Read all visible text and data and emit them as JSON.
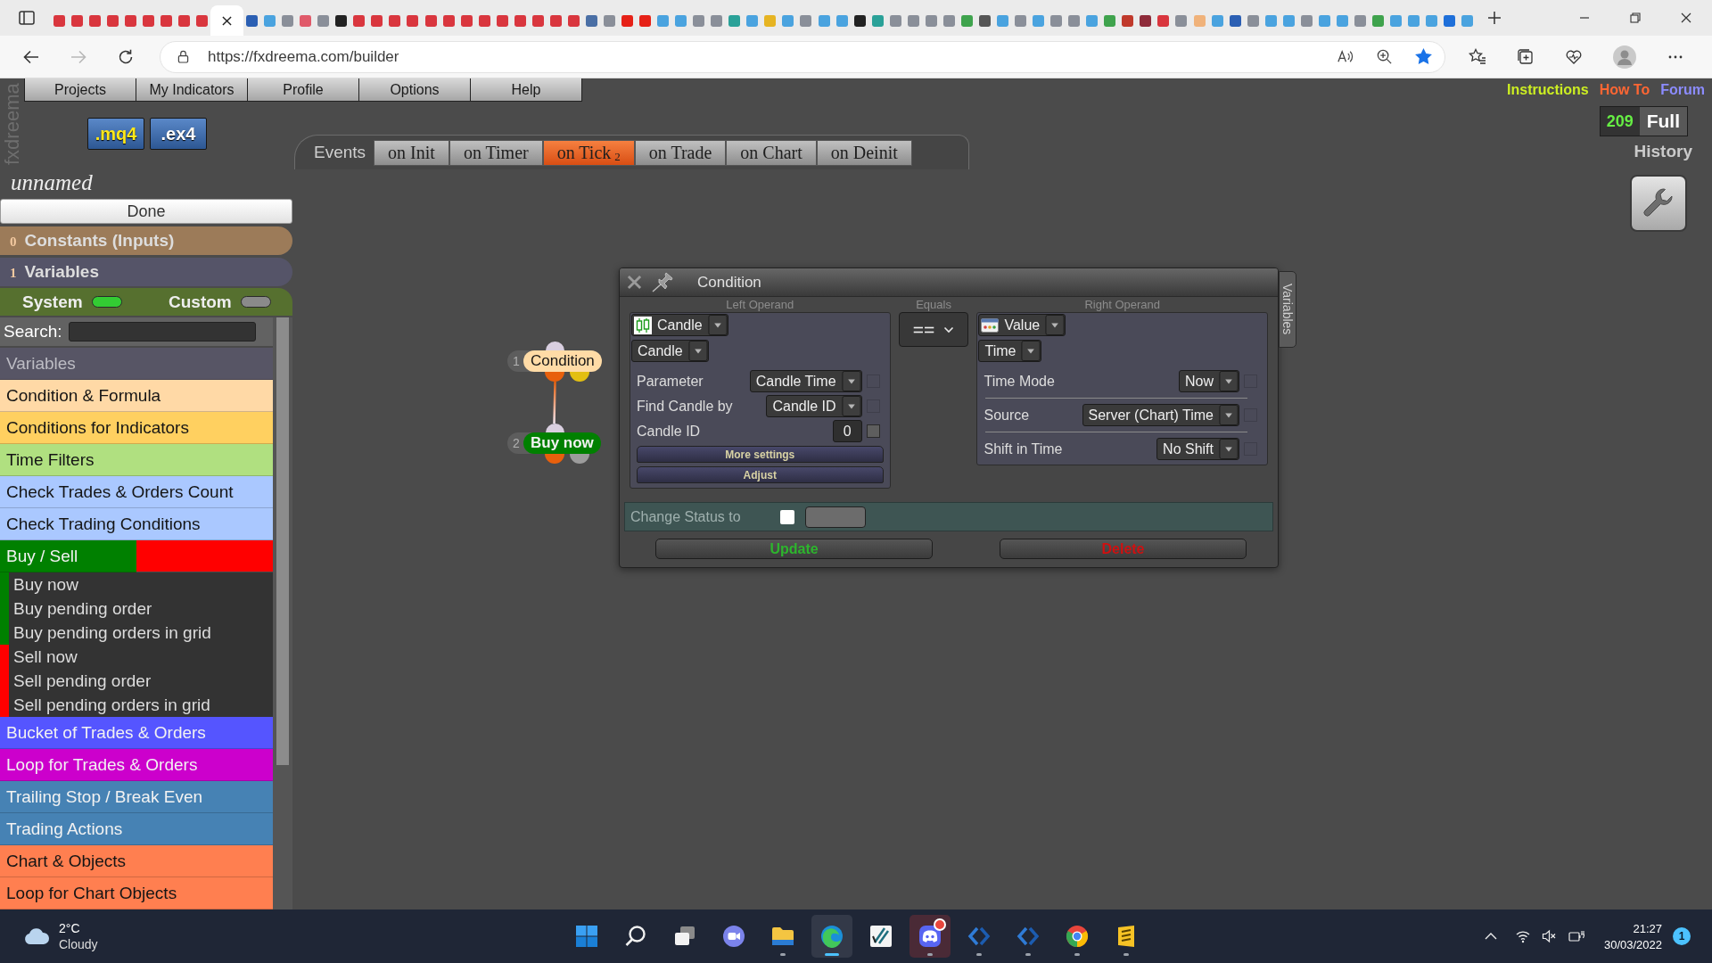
{
  "browser": {
    "tabs": [
      {
        "selected": false,
        "color": "#d9363e"
      },
      {
        "selected": false,
        "color": "#d9363e"
      },
      {
        "selected": false,
        "color": "#d9363e"
      },
      {
        "selected": false,
        "color": "#d9363e"
      },
      {
        "selected": false,
        "color": "#d9363e"
      },
      {
        "selected": false,
        "color": "#d9363e"
      },
      {
        "selected": false,
        "color": "#d9363e"
      },
      {
        "selected": false,
        "color": "#d9363e"
      },
      {
        "selected": false,
        "color": "#d9363e"
      },
      {
        "selected": true
      },
      {
        "selected": false,
        "color": "#2b5fb3"
      },
      {
        "selected": false,
        "color": "#4aa3df"
      },
      {
        "selected": false,
        "color": "#8a8f99"
      },
      {
        "selected": false,
        "color": "#e05a6a"
      },
      {
        "selected": false,
        "color": "#8a8f99"
      },
      {
        "selected": false,
        "color": "#222222"
      },
      {
        "selected": false,
        "color": "#d9363e"
      },
      {
        "selected": false,
        "color": "#d9363e"
      },
      {
        "selected": false,
        "color": "#d9363e"
      },
      {
        "selected": false,
        "color": "#d9363e"
      },
      {
        "selected": false,
        "color": "#d9363e"
      },
      {
        "selected": false,
        "color": "#d9363e"
      },
      {
        "selected": false,
        "color": "#d9363e"
      },
      {
        "selected": false,
        "color": "#d9363e"
      },
      {
        "selected": false,
        "color": "#d9363e"
      },
      {
        "selected": false,
        "color": "#d9363e"
      },
      {
        "selected": false,
        "color": "#d9363e"
      },
      {
        "selected": false,
        "color": "#d9363e"
      },
      {
        "selected": false,
        "color": "#d9363e"
      },
      {
        "selected": false,
        "color": "#4a6fa5"
      },
      {
        "selected": false,
        "color": "#8a8f99"
      },
      {
        "selected": false,
        "color": "#e62117"
      },
      {
        "selected": false,
        "color": "#e62117"
      },
      {
        "selected": false,
        "color": "#4aa3df"
      },
      {
        "selected": false,
        "color": "#4aa3df"
      },
      {
        "selected": false,
        "color": "#8a8f99"
      },
      {
        "selected": false,
        "color": "#8a8f99"
      },
      {
        "selected": false,
        "color": "#2aa198"
      },
      {
        "selected": false,
        "color": "#4aa3df"
      },
      {
        "selected": false,
        "color": "#e6b422"
      },
      {
        "selected": false,
        "color": "#4aa3df"
      },
      {
        "selected": false,
        "color": "#8a8f99"
      },
      {
        "selected": false,
        "color": "#4aa3df"
      },
      {
        "selected": false,
        "color": "#4aa3df"
      },
      {
        "selected": false,
        "color": "#222222"
      },
      {
        "selected": false,
        "color": "#2aa198"
      },
      {
        "selected": false,
        "color": "#8a8f99"
      },
      {
        "selected": false,
        "color": "#8a8f99"
      },
      {
        "selected": false,
        "color": "#8a8f99"
      },
      {
        "selected": false,
        "color": "#8a8f99"
      },
      {
        "selected": false,
        "color": "#3fa34d"
      },
      {
        "selected": false,
        "color": "#555555"
      },
      {
        "selected": false,
        "color": "#4aa3df"
      },
      {
        "selected": false,
        "color": "#8a8f99"
      },
      {
        "selected": false,
        "color": "#4aa3df"
      },
      {
        "selected": false,
        "color": "#8a8f99"
      },
      {
        "selected": false,
        "color": "#8a8f99"
      },
      {
        "selected": false,
        "color": "#4aa3df"
      },
      {
        "selected": false,
        "color": "#3fa34d"
      },
      {
        "selected": false,
        "color": "#c0392b"
      },
      {
        "selected": false,
        "color": "#8e2b3a"
      },
      {
        "selected": false,
        "color": "#d9363e"
      },
      {
        "selected": false,
        "color": "#8a8f99"
      },
      {
        "selected": false,
        "color": "#f0b27a"
      },
      {
        "selected": false,
        "color": "#4aa3df"
      },
      {
        "selected": false,
        "color": "#2b5fb3"
      },
      {
        "selected": false,
        "color": "#8a8f99"
      },
      {
        "selected": false,
        "color": "#4aa3df"
      },
      {
        "selected": false,
        "color": "#4aa3df"
      },
      {
        "selected": false,
        "color": "#8a8f99"
      },
      {
        "selected": false,
        "color": "#4aa3df"
      },
      {
        "selected": false,
        "color": "#4aa3df"
      },
      {
        "selected": false,
        "color": "#8a8f99"
      },
      {
        "selected": false,
        "color": "#3fa34d"
      },
      {
        "selected": false,
        "color": "#4aa3df"
      },
      {
        "selected": false,
        "color": "#4aa3df"
      },
      {
        "selected": false,
        "color": "#4aa3df"
      },
      {
        "selected": false,
        "color": "#1e6fd9"
      },
      {
        "selected": false,
        "color": "#4aa3df"
      }
    ],
    "nav": [
      {
        "kind": "back",
        "disabled": false
      },
      {
        "kind": "forward",
        "disabled": true
      },
      {
        "kind": "refresh",
        "disabled": false
      }
    ],
    "address": "https://fxdreema.com/builder",
    "favorited": true
  },
  "app": {
    "logo": "fxdreema",
    "menu": [
      "Projects",
      "My Indicators",
      "Profile",
      "Options",
      "Help"
    ],
    "links": [
      {
        "label": "Instructions",
        "color": "#ccee22"
      },
      {
        "label": "How To",
        "color": "#ff6633"
      },
      {
        "label": "Forum",
        "color": "#8c8cff"
      }
    ],
    "exports": [
      {
        "label": ".mq4",
        "kind": "source"
      },
      {
        "label": ".ex4",
        "kind": "compiled"
      }
    ],
    "events": {
      "label": "Events",
      "tabs": [
        {
          "label": "on Init",
          "selected": false
        },
        {
          "label": "on Timer",
          "selected": false
        },
        {
          "label": "on Tick",
          "count": "2",
          "selected": true
        },
        {
          "label": "on Trade",
          "selected": false
        },
        {
          "label": "on Chart",
          "selected": false
        },
        {
          "label": "on Deinit",
          "selected": false
        }
      ]
    },
    "stats": {
      "count": "209",
      "plan": "Full",
      "history": "History"
    },
    "project": {
      "name": "unnamed",
      "done": "Done"
    },
    "sections": [
      {
        "count": "0",
        "label": "Constants (Inputs)",
        "color": "#9c7b59"
      },
      {
        "count": "1",
        "label": "Variables",
        "color": "#555468"
      }
    ],
    "scope_toggles": [
      {
        "label": "System",
        "on": true
      },
      {
        "label": "Custom",
        "on": false
      }
    ],
    "search": {
      "label": "Search:"
    },
    "blocks": [
      {
        "label": "Variables",
        "kind": "muted",
        "color": "#575565"
      },
      {
        "label": "Condition & Formula",
        "kind": "category",
        "color": "#ffd9a6"
      },
      {
        "label": "Conditions for Indicators",
        "kind": "category",
        "color": "#ffd060"
      },
      {
        "label": "Time Filters",
        "kind": "category",
        "color": "#b0e080"
      },
      {
        "label": "Check Trades & Orders Count",
        "kind": "category",
        "color": "#aac8ff"
      },
      {
        "label": "Check Trading Conditions",
        "kind": "category",
        "color": "#aac8ff"
      },
      {
        "label": "Buy / Sell",
        "kind": "split",
        "halves": [
          {
            "color": "#008000"
          },
          {
            "color": "#ff0000"
          }
        ],
        "children": [
          {
            "label": "Buy now",
            "color": "#008000"
          },
          {
            "label": "Buy pending order",
            "color": "#008000"
          },
          {
            "label": "Buy pending orders in grid",
            "color": "#008000"
          },
          {
            "label": "Sell now",
            "color": "#ff0000"
          },
          {
            "label": "Sell pending order",
            "color": "#ff0000"
          },
          {
            "label": "Sell pending orders in grid",
            "color": "#ff0000"
          }
        ]
      },
      {
        "label": "Bucket of Trades & Orders",
        "kind": "category",
        "color": "#5555ff"
      },
      {
        "label": "Loop for Trades & Orders",
        "kind": "category",
        "color": "#cc00cc"
      },
      {
        "label": "Trailing Stop / Break Even",
        "kind": "category",
        "color": "#4682b4"
      },
      {
        "label": "Trading Actions",
        "kind": "category",
        "color": "#4682b4"
      },
      {
        "label": "Chart & Objects",
        "kind": "category",
        "color": "#ff7f50"
      },
      {
        "label": "Loop for Chart Objects",
        "kind": "category",
        "color": "#ff7f50"
      }
    ]
  },
  "canvas": {
    "nodes": [
      {
        "number": "1",
        "label": "Condition",
        "kind": "condition",
        "color": "#ffdba6",
        "outputs": [
          {
            "color": "#e8600c",
            "linked": true
          },
          {
            "color": "#e3bf12",
            "linked": false
          }
        ]
      },
      {
        "number": "2",
        "label": "Buy now",
        "kind": "action",
        "color": "#008000",
        "outputs": [
          {
            "color": "#e8600c"
          },
          {
            "color": "#9c9c9c"
          }
        ]
      }
    ]
  },
  "dialog": {
    "title": "Condition",
    "side_tab": "Variables",
    "left": {
      "label": "Left Operand",
      "source": "Candle",
      "type": "Candle",
      "params": [
        {
          "label": "Parameter",
          "kind": "dropdown",
          "value": "Candle Time",
          "checkbox": {
            "checked": false,
            "disabled": true
          }
        },
        {
          "label": "Find Candle by",
          "kind": "dropdown",
          "value": "Candle ID",
          "checkbox": {
            "checked": false,
            "disabled": true
          }
        },
        {
          "label": "Candle ID",
          "kind": "number",
          "value": "0",
          "checkbox": {
            "checked": false,
            "disabled": false
          }
        }
      ],
      "actions": [
        "More settings",
        "Adjust"
      ]
    },
    "equals": {
      "label": "Equals",
      "value": "=="
    },
    "right": {
      "label": "Right Operand",
      "source": "Value",
      "type": "Time",
      "params": [
        {
          "label": "Time Mode",
          "kind": "dropdown",
          "value": "Now",
          "checkbox": {
            "checked": false,
            "disabled": true
          }
        },
        {
          "label": "Source",
          "kind": "dropdown",
          "value": "Server (Chart) Time",
          "checkbox": {
            "checked": false,
            "disabled": true
          }
        },
        {
          "label": "Shift in Time",
          "kind": "dropdown",
          "value": "No Shift",
          "checkbox": {
            "checked": false,
            "disabled": true
          }
        }
      ]
    },
    "status": {
      "label": "Change Status to",
      "checked": false
    },
    "buttons": [
      {
        "label": "Update",
        "color": "#2db52d"
      },
      {
        "label": "Delete",
        "color": "#d01010"
      }
    ]
  },
  "taskbar": {
    "weather": {
      "temperature": "2°C",
      "condition": "Cloudy"
    },
    "apps": [
      {
        "kind": "start",
        "running": false,
        "active": false,
        "alert": false
      },
      {
        "kind": "search",
        "running": false,
        "active": false,
        "alert": false
      },
      {
        "kind": "taskview",
        "running": false,
        "active": false,
        "alert": false
      },
      {
        "kind": "chat",
        "running": false,
        "active": false,
        "alert": false
      },
      {
        "kind": "explorer",
        "running": true,
        "active": false,
        "alert": false
      },
      {
        "kind": "edge",
        "running": true,
        "active": true,
        "alert": false
      },
      {
        "kind": "tile",
        "running": false,
        "active": false,
        "alert": false
      },
      {
        "kind": "discord",
        "running": true,
        "active": false,
        "alert": true
      },
      {
        "kind": "devtool",
        "running": true,
        "active": false,
        "alert": false
      },
      {
        "kind": "devtool",
        "running": true,
        "active": false,
        "alert": false
      },
      {
        "kind": "chrome",
        "running": true,
        "active": false,
        "alert": false
      },
      {
        "kind": "notes",
        "running": true,
        "active": false,
        "alert": false
      }
    ],
    "tray": {
      "muted": true,
      "time": "21:27",
      "date": "30/03/2022",
      "notifications": "1"
    }
  }
}
